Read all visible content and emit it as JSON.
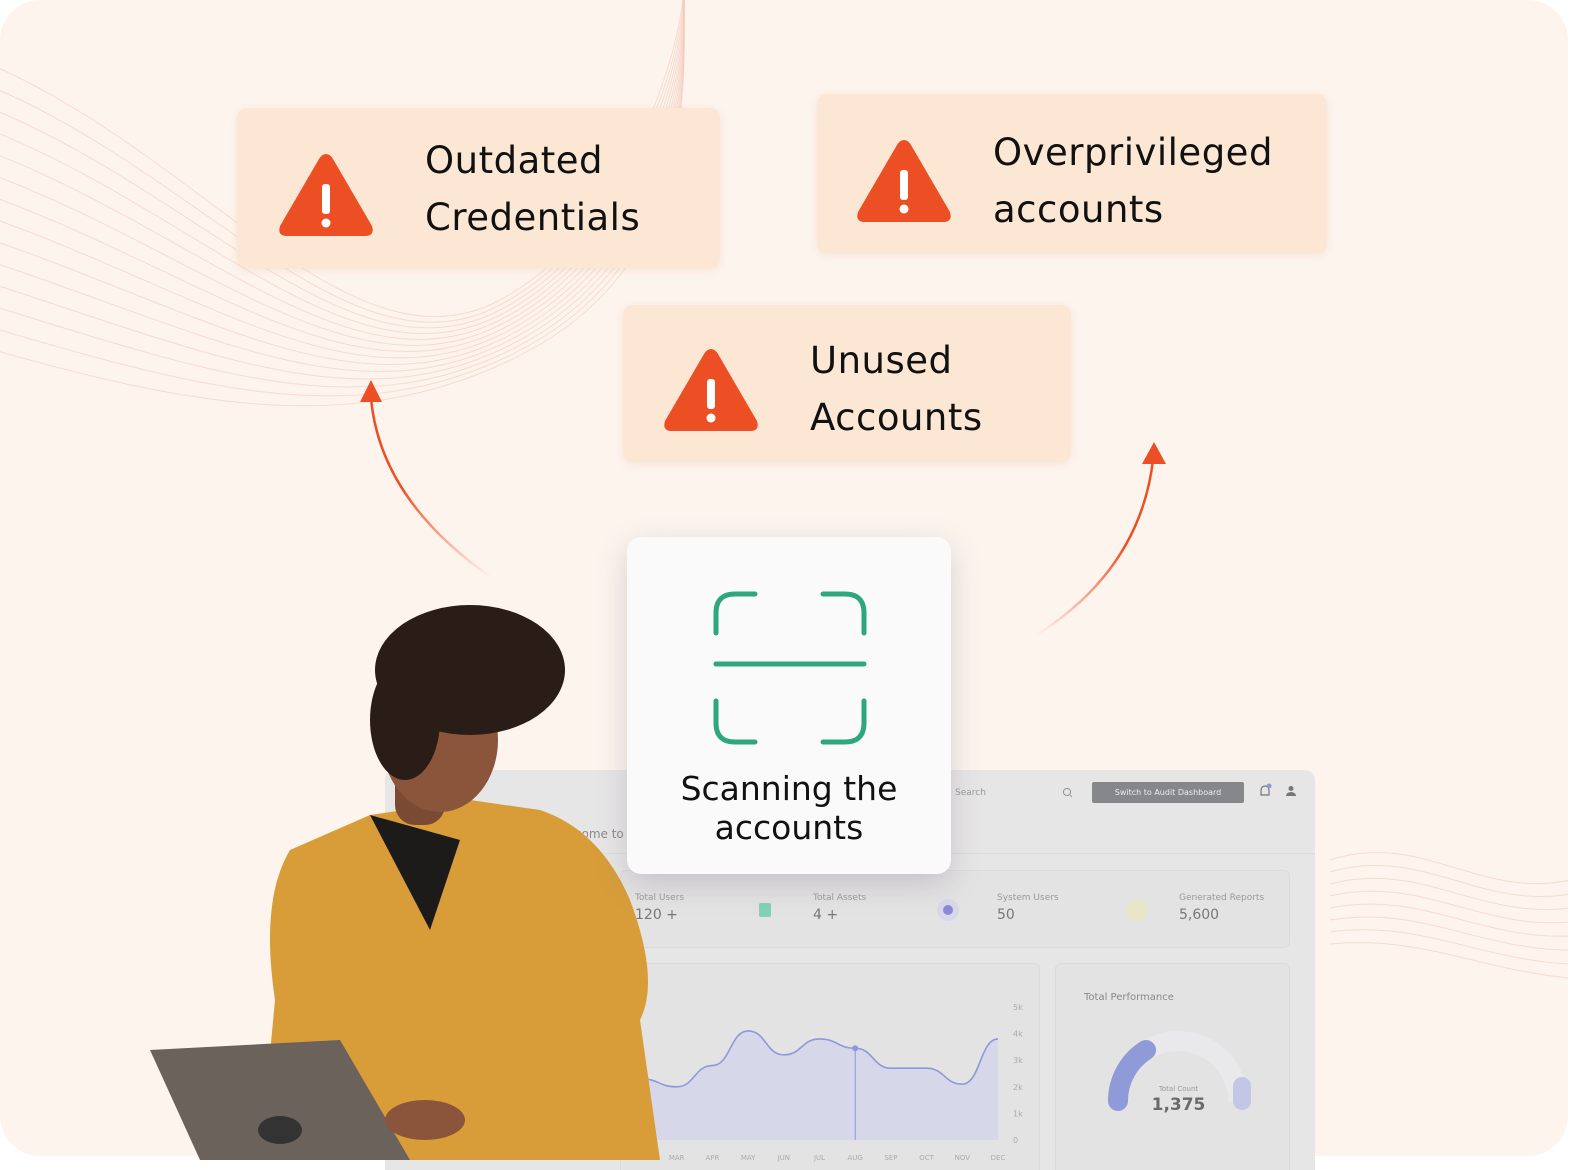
{
  "alerts": [
    {
      "line1": "Outdated",
      "line2": "Credentials",
      "icon": "warning-triangle-icon"
    },
    {
      "line1": "Overprivileged",
      "line2": "accounts",
      "icon": "warning-triangle-icon"
    },
    {
      "line1": "Unused",
      "line2": "Accounts",
      "icon": "warning-triangle-icon"
    }
  ],
  "scan": {
    "line1": "Scanning the",
    "line2": "accounts",
    "icon": "scan-icon"
  },
  "dashboard": {
    "search_placeholder": "Search",
    "switch_button": "Switch to Audit Dashboard",
    "welcome": "Welcome to your Dashboard",
    "stats": [
      {
        "label": "Total Users",
        "value": "120 +"
      },
      {
        "label": "Total Assets",
        "value": "4 +"
      },
      {
        "label": "System Users",
        "value": "50"
      },
      {
        "label": "Generated Reports",
        "value": "5,600"
      }
    ],
    "performance": {
      "title": "Total Performance",
      "count_label": "Total Count",
      "count": "1,375",
      "fill": 0.3
    }
  },
  "colors": {
    "accent": "#ec4f24",
    "scan": "#2ea67e",
    "card": "#fbe7d4",
    "background": "#fdf4ee",
    "chart_line": "#8f98d8"
  },
  "chart_data": {
    "type": "area",
    "x": [
      "FEB",
      "MAR",
      "APR",
      "MAY",
      "JUN",
      "JUL",
      "AUG",
      "SEP",
      "OCT",
      "NOV",
      "DEC"
    ],
    "values": [
      2.3,
      2.0,
      2.8,
      4.1,
      3.2,
      3.8,
      3.45,
      2.7,
      2.7,
      2.1,
      3.8
    ],
    "y_ticks": [
      "0",
      "1k",
      "2k",
      "3k",
      "4k",
      "5k"
    ],
    "ylim": [
      0,
      5
    ],
    "highlight": "AUG"
  }
}
